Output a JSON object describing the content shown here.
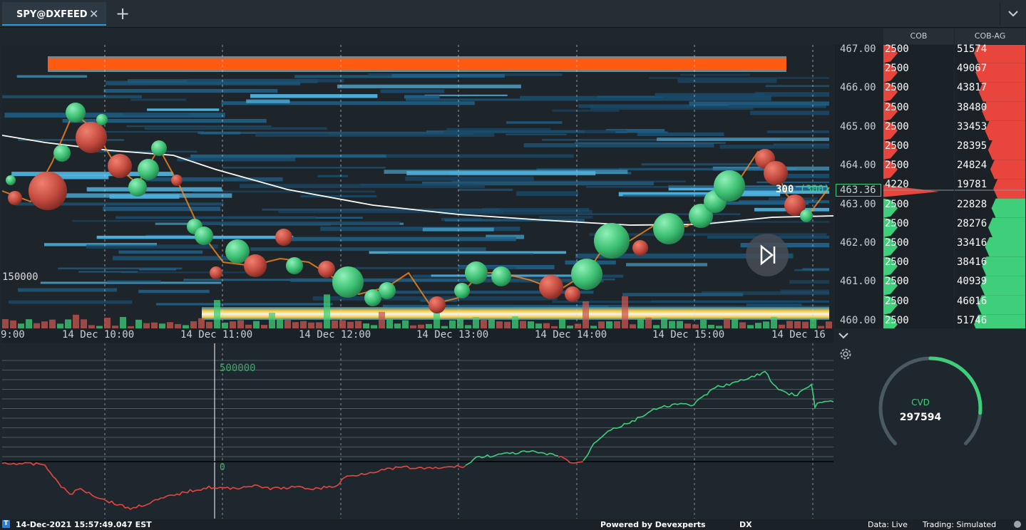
{
  "tab": {
    "title": "SPY@DXFEED"
  },
  "columns": {
    "cob": "COB",
    "cobag": "COB-AG"
  },
  "price_labels": [
    "467.00",
    "466.00",
    "465.00",
    "464.00",
    "463.00",
    "462.00",
    "461.00",
    "460.00"
  ],
  "current_price": "463.36",
  "cob_values": [
    "2500",
    "2500",
    "2500",
    "2500",
    "2500",
    "2500",
    "2500",
    "4220",
    "2500",
    "2500",
    "2500",
    "2500",
    "2500",
    "2500",
    "2500"
  ],
  "cobag_values": [
    "51574",
    "49067",
    "43817",
    "38480",
    "33453",
    "28395",
    "24824",
    "19781",
    "22828",
    "28276",
    "33416",
    "38416",
    "40939",
    "46016",
    "51746"
  ],
  "time_labels": [
    "9:00",
    "14 Dec 10:00",
    "14 Dec 11:00",
    "14 Dec 12:00",
    "14 Dec 13:00",
    "14 Dec 14:00",
    "14 Dec 15:00",
    "14 Dec 16"
  ],
  "volume_label": "150000",
  "cursor_label": {
    "size": "300",
    "size_agg": "(300)"
  },
  "lower_labels": {
    "level": "500000",
    "zero": "0"
  },
  "cvd": {
    "label": "CVD",
    "value": "297594",
    "fraction": 0.42
  },
  "status": {
    "datetime": "14-Dec-2021 15:57:49.047 EST",
    "powered": "Powered by Devexperts",
    "dx": "DX",
    "data": "Data: Live",
    "trading": "Trading: Simulated"
  },
  "colors": {
    "accent": "#2a9fd8",
    "buy": "#3fcf7a",
    "sell": "#e8463c",
    "vwap": "#ffffff"
  },
  "icons": [
    "close-icon",
    "plus-icon",
    "chevron-down-icon",
    "skip-to-end-icon",
    "gear-icon",
    "app-icon",
    "connection-icon"
  ]
}
